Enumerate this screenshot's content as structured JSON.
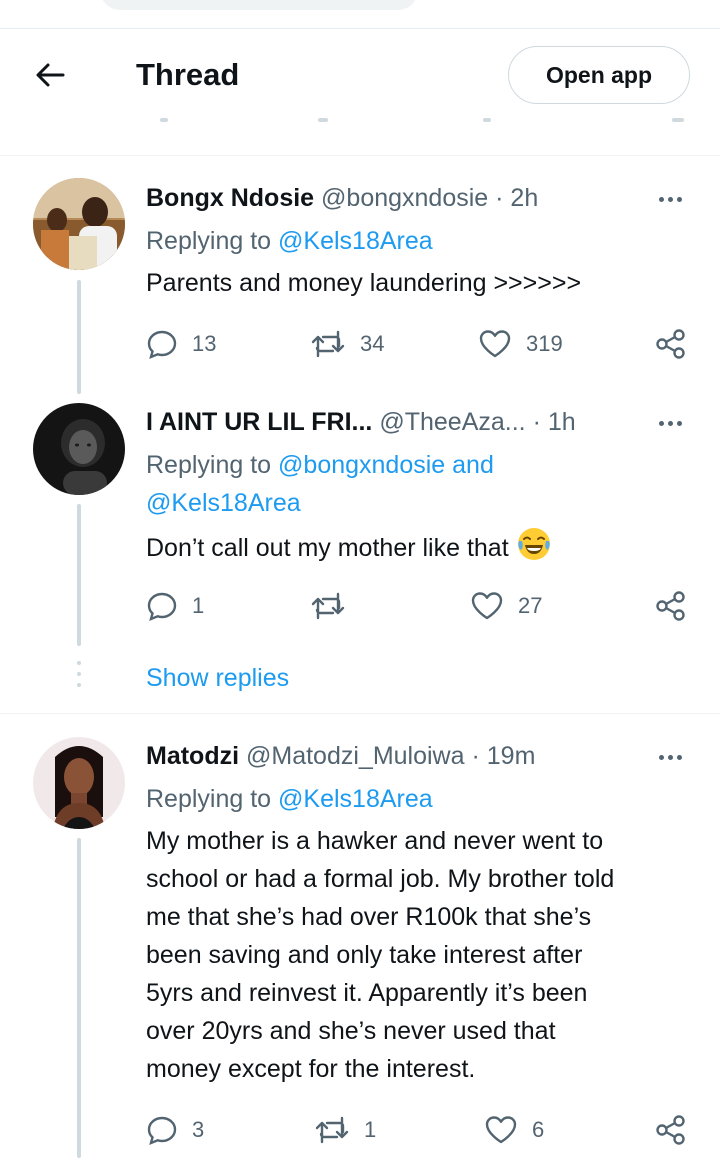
{
  "header": {
    "title": "Thread",
    "open_app_label": "Open app",
    "back_icon": "arrow-left-icon"
  },
  "tweets": [
    {
      "name": "Bongx Ndosie",
      "handle": "@bongxndosie",
      "time": "· 2h",
      "replying_prefix": "Replying to",
      "replying_to": [
        "@Kels18Area"
      ],
      "text": "Parents and money laundering >>>>>>",
      "replies": "13",
      "retweets": "34",
      "likes": "319"
    },
    {
      "name": "I AINT UR LIL FRI...",
      "handle": "@TheeAza...",
      "time": "· 1h",
      "replying_prefix": "Replying to",
      "replying_to": [
        "@bongxndosie",
        "and",
        "@Kels18Area"
      ],
      "text": "Don’t call out my mother like that",
      "emoji": "face-with-tears-of-joy",
      "replies": "1",
      "retweets": "",
      "likes": "27"
    },
    {
      "name": "Matodzi",
      "handle": "@Matodzi_Muloiwa",
      "time": "· 19m",
      "replying_prefix": "Replying to",
      "replying_to": [
        "@Kels18Area"
      ],
      "text_lines": [
        "My mother is a hawker and never went to",
        "school or had a formal job. My brother told",
        "me that she’s had over R100k that she’s",
        "been saving and only take interest after",
        "5yrs and reinvest it. Apparently it’s been",
        "over 20yrs and she’s never used that",
        "money except for the interest."
      ],
      "replies": "3",
      "retweets": "1",
      "likes": "6"
    }
  ],
  "show_replies_label": "Show replies",
  "colors": {
    "link": "#1d9bf0",
    "secondary": "#536471",
    "text": "#0f1419",
    "divider": "#eff3f4"
  }
}
